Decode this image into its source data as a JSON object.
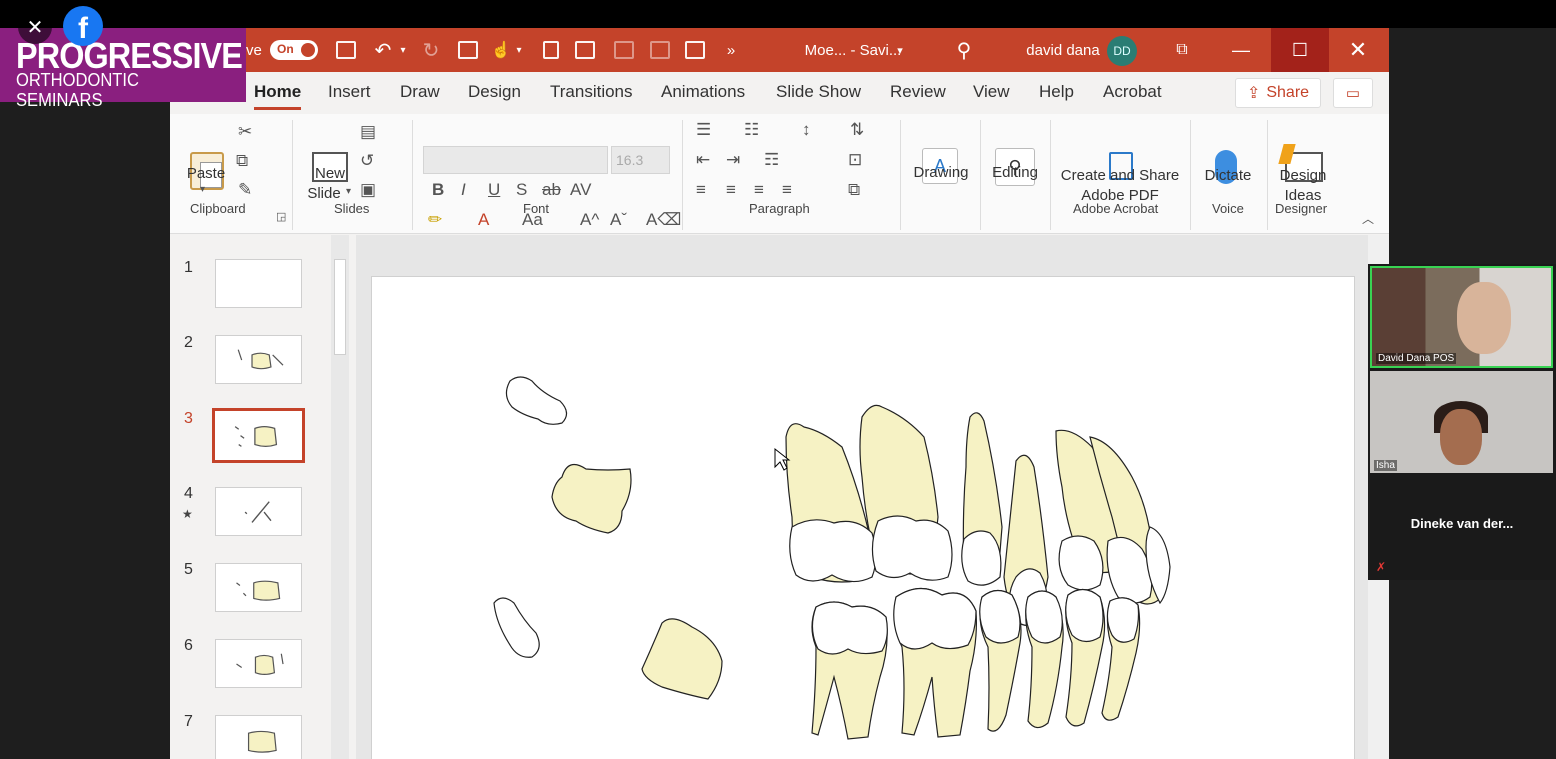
{
  "window": {
    "autosave_label": "ve",
    "autosave_state": "On",
    "doc_title": "Moe...  -  Savi...",
    "user_name": "david dana",
    "user_initials": "DD"
  },
  "branding": {
    "line1": "PROGRESSIVE",
    "line2": "ORTHODONTIC SEMINARS"
  },
  "tabs": [
    "Home",
    "Insert",
    "Draw",
    "Design",
    "Transitions",
    "Animations",
    "Slide Show",
    "Review",
    "View",
    "Help",
    "Acrobat"
  ],
  "active_tab": "Home",
  "share_label": "Share",
  "ribbon": {
    "clipboard": {
      "paste": "Paste",
      "group": "Clipboard"
    },
    "slides": {
      "new_slide_1": "New",
      "new_slide_2": "Slide",
      "group": "Slides"
    },
    "font": {
      "size": "16.3",
      "group": "Font"
    },
    "paragraph": {
      "group": "Paragraph"
    },
    "drawing": "Drawing",
    "editing": "Editing",
    "acrobat": {
      "label1": "Create and Share",
      "label2": "Adobe PDF",
      "group": "Adobe Acrobat"
    },
    "voice": {
      "dictate": "Dictate",
      "group": "Voice"
    },
    "designer": {
      "label1": "Design",
      "label2": "Ideas",
      "group": "Designer"
    }
  },
  "slides": [
    {
      "num": "1"
    },
    {
      "num": "2"
    },
    {
      "num": "3"
    },
    {
      "num": "4"
    },
    {
      "num": "5"
    },
    {
      "num": "6"
    },
    {
      "num": "7"
    }
  ],
  "active_slide": "3",
  "participants": [
    {
      "name": "David Dana POS"
    },
    {
      "name": "Isha"
    },
    {
      "name": "Dineke van der..."
    }
  ],
  "colors": {
    "accent": "#c4432a",
    "brand": "#8a1f7f",
    "tooth_root": "#f6f2c4"
  }
}
